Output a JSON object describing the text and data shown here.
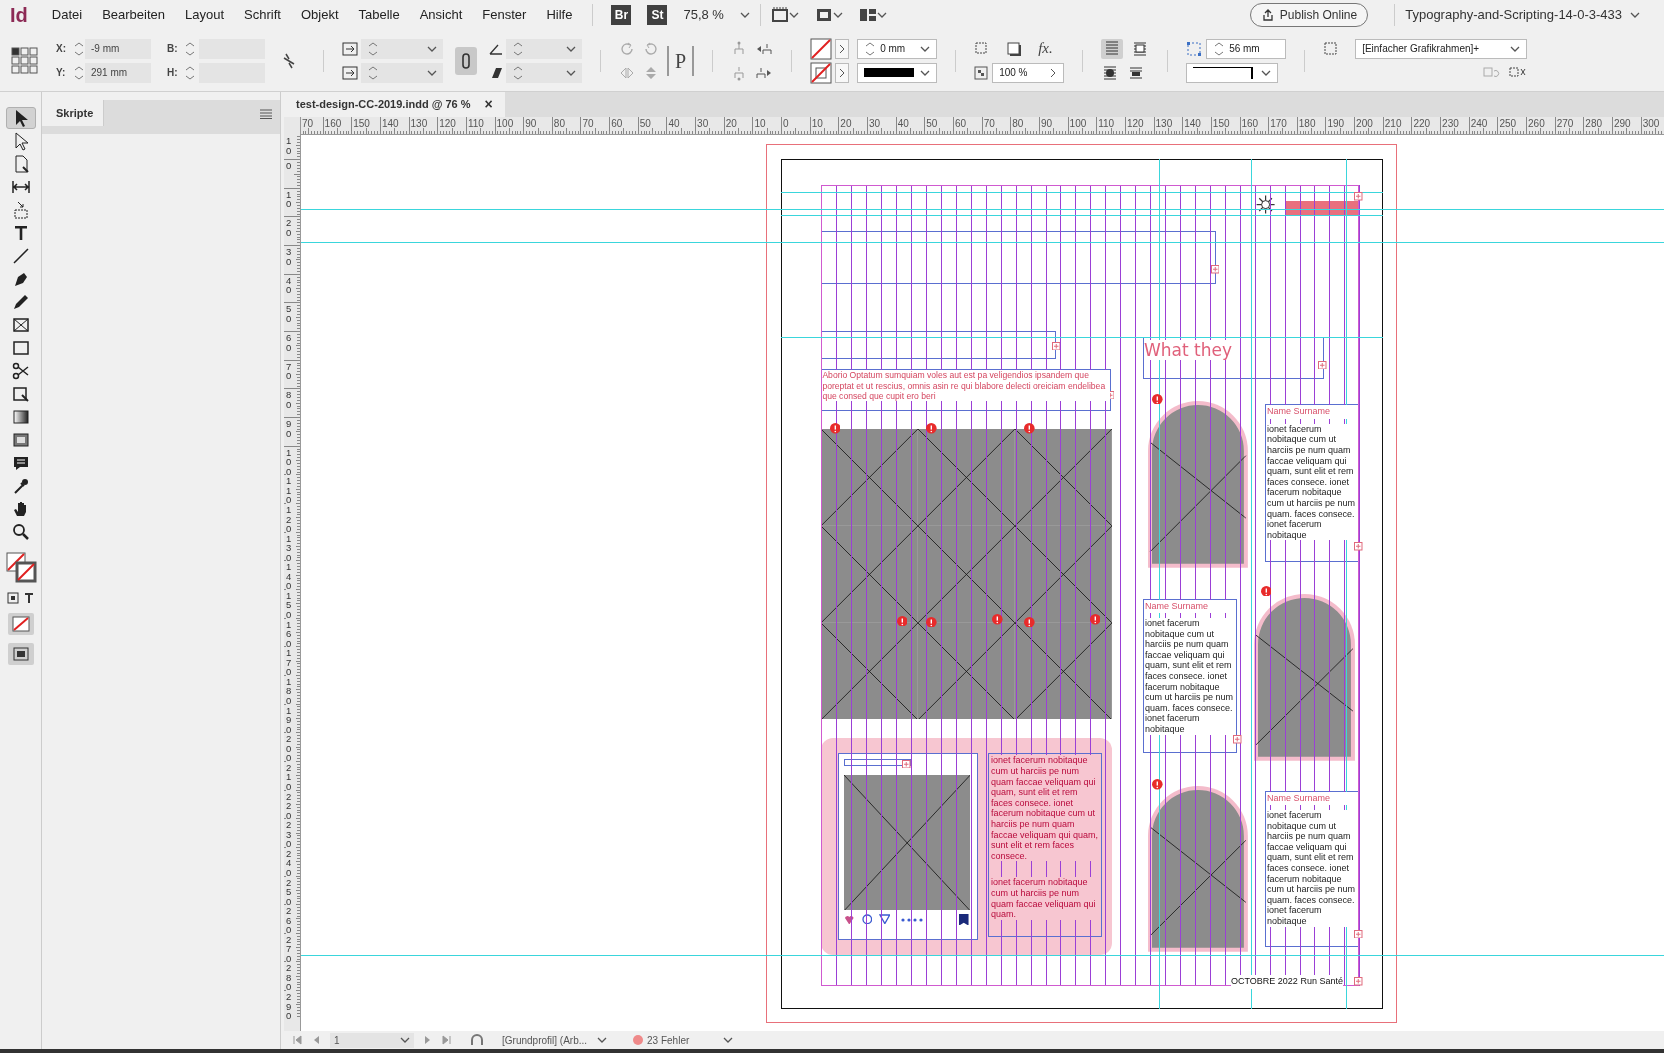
{
  "app": {
    "logo": "Id",
    "menu": [
      "Datei",
      "Bearbeiten",
      "Layout",
      "Schrift",
      "Objekt",
      "Tabelle",
      "Ansicht",
      "Fenster",
      "Hilfe"
    ],
    "bridge": "Br",
    "stock": "St",
    "zoom": "75,8 %",
    "publish": "Publish Online",
    "workspace": "Typography-and-Scripting-14-0-3-433"
  },
  "control_bar": {
    "x_label": "X:",
    "x": "-9 mm",
    "y_label": "Y:",
    "y": "291 mm",
    "w_label": "B:",
    "h_label": "H:",
    "p_glyph": "P",
    "stroke_weight": "0 mm",
    "opacity": "100 %",
    "fx": "fx.",
    "fitting": "56 mm",
    "object_style": "[Einfacher Grafikrahmen]+"
  },
  "tools": [
    {
      "selected": true
    },
    {
      "selected": false
    },
    {
      "selected": false
    },
    {
      "selected": false
    },
    {
      "selected": false
    },
    {
      "selected": false
    },
    {
      "selected": false
    },
    {
      "selected": false
    },
    {
      "selected": false
    },
    {
      "selected": false
    },
    {
      "selected": false
    },
    {
      "selected": false
    },
    {
      "selected": false
    },
    {
      "selected": false
    },
    {
      "selected": false
    },
    {
      "selected": false
    },
    {
      "selected": false
    },
    {
      "selected": false
    },
    {
      "selected": false
    }
  ],
  "panel": {
    "title": "Skripte"
  },
  "document": {
    "tab": "test-design-CC-2019.indd @ 76 %",
    "close": "×"
  },
  "rulers": {
    "horizontal": [
      "70",
      "160",
      "150",
      "140",
      "130",
      "120",
      "110",
      "100",
      "90",
      "80",
      "70",
      "60",
      "50",
      "40",
      "30",
      "20",
      "10",
      "0",
      "10",
      "20",
      "30",
      "40",
      "50",
      "60",
      "70",
      "80",
      "90",
      "100",
      "110",
      "120",
      "130",
      "140",
      "150",
      "160",
      "170",
      "180",
      "190",
      "200",
      "210",
      "220",
      "230",
      "240",
      "250",
      "260",
      "270",
      "280",
      "290",
      "300"
    ],
    "vertical": [
      "10",
      "0",
      "10",
      "20",
      "30",
      "40",
      "50",
      "60",
      "70",
      "80",
      "90",
      "100",
      "110",
      "120",
      "130",
      "140",
      "150",
      "160",
      "170",
      "180",
      "190",
      "200",
      "210",
      "220",
      "230",
      "240",
      "250",
      "260",
      "270",
      "280",
      "290"
    ]
  },
  "page": {
    "heading": "What they",
    "intro": "Aborio Optatum sumquiam voles aut est pa veligendios ipsandem que poreptat et ut rescius, omnis asin re qui blabore delecti oreiciam endelibea que consed que cupit ero beri",
    "profiles": [
      {
        "name": "Name Surname",
        "bio": "ionet facerum nobitaque cum ut harciis pe num quam faccae veliquam qui quam, sunt elit et rem faces consece. ionet facerum nobitaque cum ut harciis pe num quam. faces consece. ionet facerum nobitaque"
      },
      {
        "name": "Name Surname",
        "bio": "ionet facerum nobitaque cum ut harciis pe num quam faccae veliquam qui quam, sunt elit et rem faces consece. ionet facerum nobitaque cum ut harciis pe num quam. faces consece. ionet facerum nobitaque"
      },
      {
        "name": "Name Surname",
        "bio": "ionet facerum nobitaque cum ut harciis pe num quam faccae veliquam qui quam, sunt elit et rem faces consece. ionet facerum nobitaque cum ut harciis pe num quam. faces consece. ionet facerum nobitaque"
      }
    ],
    "card_text": [
      "ionet facerum nobitaque cum ut harciis pe num quam faccae veliquam qui quam, sunt elit et rem faces consece. ionet facerum nobitaque cum ut harciis pe num quam faccae veliquam qui quam, sunt elit et rem faces consece.",
      "ionet facerum nobitaque cum ut harciis pe num quam faccae veliquam qui quam."
    ],
    "footer": "OCTOBRE 2022 Run Santé"
  },
  "status_bar": {
    "page": "1",
    "profile": "[Grundprofil] (Arb...",
    "errors": "23 Fehler"
  }
}
